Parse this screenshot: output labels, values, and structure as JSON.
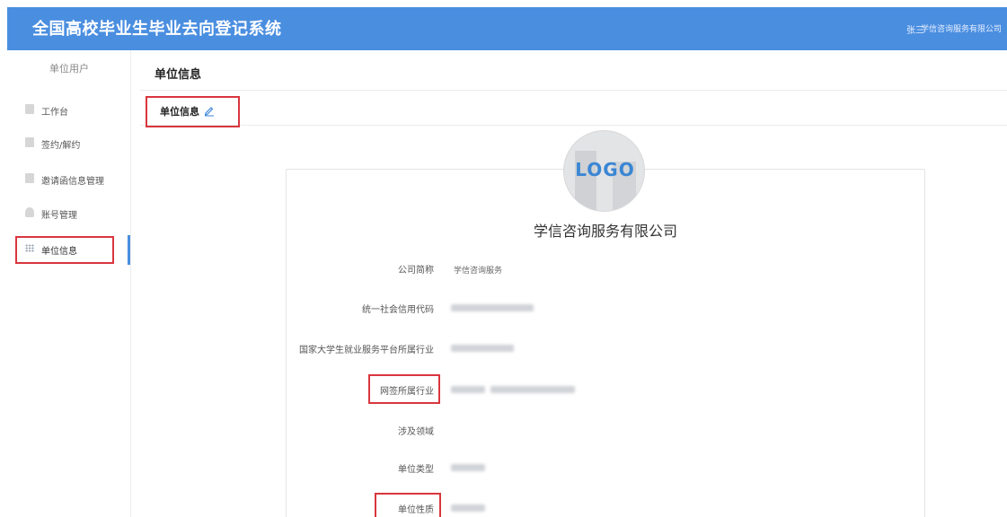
{
  "header": {
    "title": "全国高校毕业生毕业去向登记系统",
    "user_name": "张三",
    "org_name": "学信咨询服务有限公司"
  },
  "sidebar": {
    "header": "单位用户",
    "items": [
      {
        "label": "工作台",
        "icon": "dashboard-icon"
      },
      {
        "label": "签约/解约",
        "icon": "contract-icon"
      },
      {
        "label": "邀请函信息管理",
        "icon": "invitation-icon"
      },
      {
        "label": "账号管理",
        "icon": "user-icon"
      },
      {
        "label": "单位信息",
        "icon": "grid-icon",
        "active": true
      }
    ]
  },
  "main": {
    "title": "单位信息",
    "tab_label": "单位信息",
    "logo_text": "LOGO",
    "company_name": "学信咨询服务有限公司",
    "fields": [
      {
        "label": "公司简称",
        "value": "学信咨询服务"
      },
      {
        "label": "统一社会信用代码",
        "value": ""
      },
      {
        "label": "国家大学生就业服务平台所属行业",
        "value": ""
      },
      {
        "label": "网签所属行业",
        "value": ""
      },
      {
        "label": "涉及领域",
        "value": ""
      },
      {
        "label": "单位类型",
        "value": ""
      },
      {
        "label": "单位性质",
        "value": ""
      }
    ]
  },
  "colors": {
    "header_bg": "#4a8ee0",
    "highlight": "#d9363e",
    "logo_text": "#3a86d4"
  }
}
